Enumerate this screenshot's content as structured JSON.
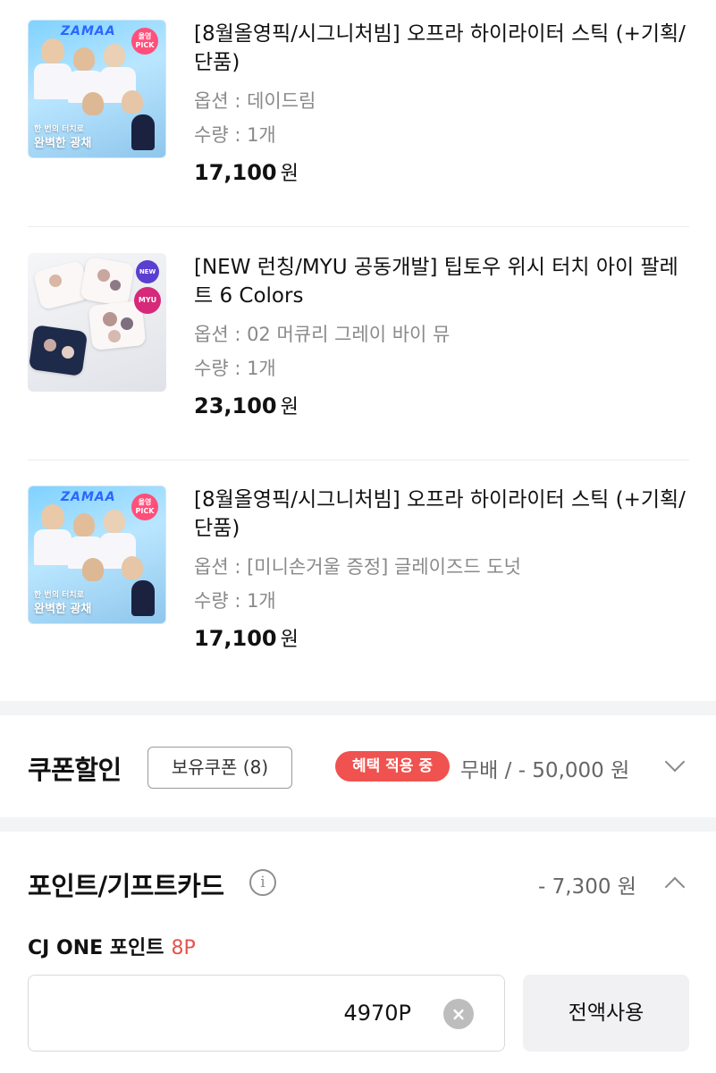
{
  "products": [
    {
      "title": "[8월올영픽/시그니처빔] 오프라 하이라이터 스틱 (+기획/단품)",
      "option": "옵션 : 데이드림",
      "quantity": "수량 : 1개",
      "price": "17,100",
      "currency": "원",
      "thumbnail": {
        "badge": "올영 PICK",
        "caption_small": "한 번의 터치로",
        "caption_large": "완벽한 광채",
        "logo": "ZAMAA"
      }
    },
    {
      "title": "[NEW 런칭/MYU 공동개발] 팁토우 위시 터치 아이 팔레트 6 Colors",
      "option": "옵션 : 02 머큐리 그레이 바이 뮤",
      "quantity": "수량 : 1개",
      "price": "23,100",
      "currency": "원",
      "thumbnail": {
        "badge_new": "NEW",
        "badge_myu": "MYU"
      }
    },
    {
      "title": "[8월올영픽/시그니처빔] 오프라 하이라이터 스틱 (+기획/단품)",
      "option": "옵션 : [미니손거울 증정] 글레이즈드 도넛",
      "quantity": "수량 : 1개",
      "price": "17,100",
      "currency": "원",
      "thumbnail": {
        "badge": "올영 PICK",
        "caption_small": "한 번의 터치로",
        "caption_large": "완벽한 광채",
        "logo": "ZAMAA"
      }
    }
  ],
  "coupon": {
    "title": "쿠폰할인",
    "owned_label": "보유쿠폰 (8)",
    "benefit_badge": "혜택 적용 중",
    "amount": "무배 / - 50,000 원"
  },
  "points": {
    "title": "포인트/기프트카드",
    "info_icon": "i",
    "amount": "- 7,300 원",
    "cj_label": "CJ ONE 포인트",
    "cj_balance": "8P",
    "input_value": "4970P",
    "clear_icon": "×",
    "use_all_label": "전액사용"
  },
  "colors": {
    "accent_red": "#f0524f",
    "point_red": "#e5534b",
    "muted_text": "#8a8a8a"
  }
}
